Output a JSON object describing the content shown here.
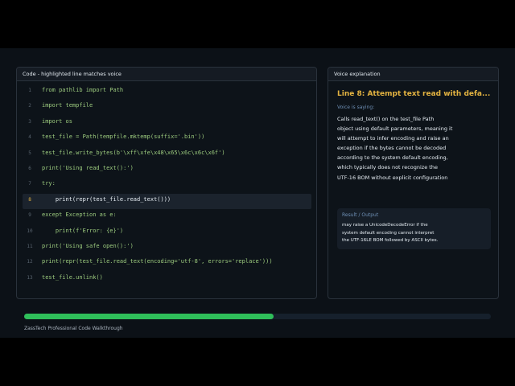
{
  "code_panel": {
    "title": "Code - highlighted line matches voice",
    "active_line": 8,
    "lines": [
      {
        "num": "1",
        "code": "from pathlib import Path"
      },
      {
        "num": "2",
        "code": "import tempfile"
      },
      {
        "num": "3",
        "code": "import os"
      },
      {
        "num": "4",
        "code": "test_file = Path(tempfile.mktemp(suffix='.bin'))"
      },
      {
        "num": "5",
        "code": "test_file.write_bytes(b'\\xff\\xfe\\x48\\x65\\x6c\\x6c\\x6f')"
      },
      {
        "num": "6",
        "code": "print('Using read_text():')"
      },
      {
        "num": "7",
        "code": "try:"
      },
      {
        "num": "8",
        "code": "    print(repr(test_file.read_text()))"
      },
      {
        "num": "9",
        "code": "except Exception as e:"
      },
      {
        "num": "10",
        "code": "    print(f'Error: {e}')"
      },
      {
        "num": "11",
        "code": "print('Using safe open():')"
      },
      {
        "num": "12",
        "code": "print(repr(test_file.read_text(encoding='utf-8', errors='replace')))"
      },
      {
        "num": "13",
        "code": "test_file.unlink()"
      }
    ]
  },
  "voice_panel": {
    "title": "Voice explanation",
    "heading": "Line 8: Attempt text read with defa...",
    "saying_label": "Voice is saying:",
    "explanation_lines": [
      "Calls read_text() on the test_file Path",
      "object using default parameters, meaning it",
      "will attempt to infer encoding and raise an",
      "exception if the bytes cannot be decoded",
      "according to the system default encoding,",
      "which typically does not recognize the",
      "UTF-16 BOM without explicit configuration"
    ],
    "result_label": "Result / Output",
    "result_lines": [
      "may raise a UnicodeDecodeError if the",
      "system default encoding cannot interpret",
      "the UTF-16LE BOM followed by ASCII bytes."
    ]
  },
  "progress": {
    "fraction": 0.534,
    "color": "#2fbf5a"
  },
  "footer": "ZassTech Professional Code Walkthrough"
}
